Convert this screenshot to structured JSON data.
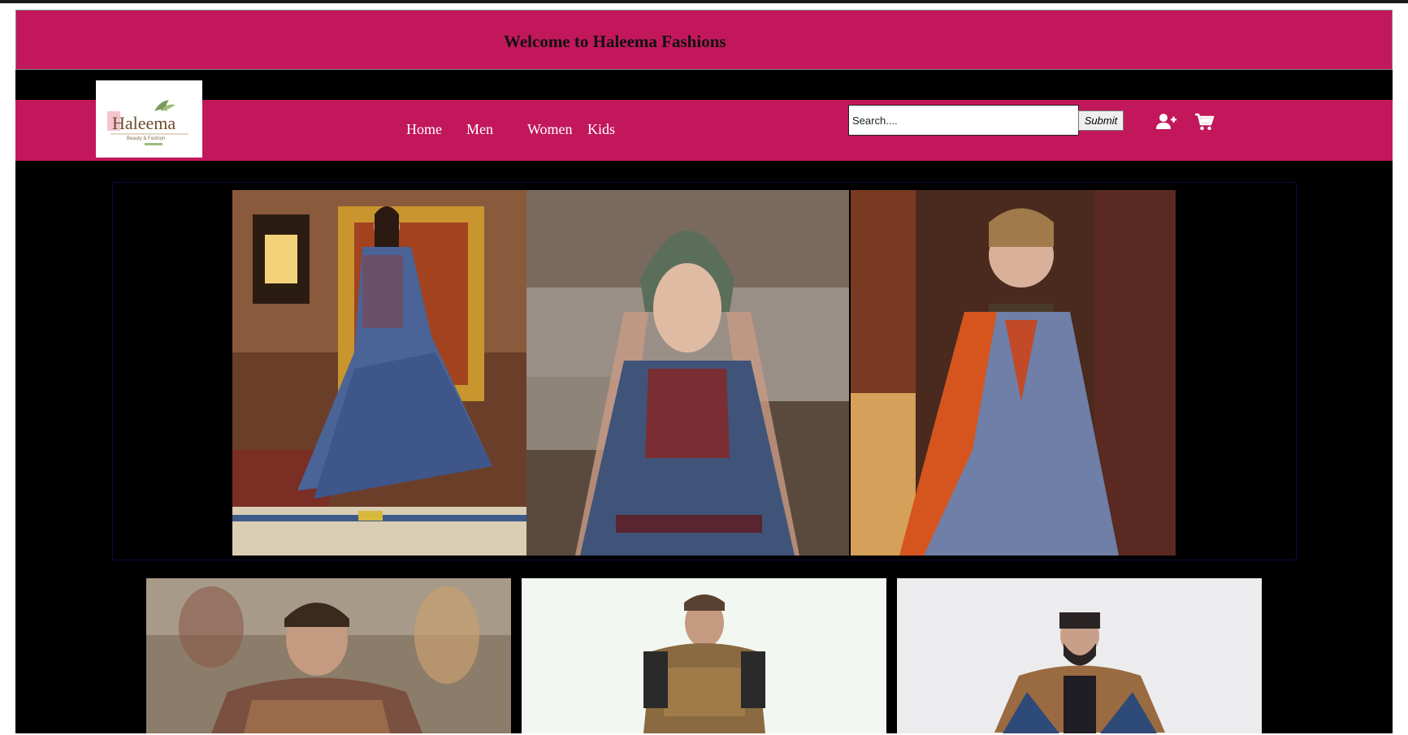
{
  "banner": {
    "welcome_text": "Welcome to Haleema Fashions"
  },
  "logo": {
    "brand": "Haleema",
    "tagline": "Beauty & Fashion"
  },
  "nav": {
    "items": [
      {
        "label": "Home"
      },
      {
        "label": "Men"
      },
      {
        "label": "Women"
      },
      {
        "label": "Kids"
      }
    ]
  },
  "search": {
    "placeholder": "Search....",
    "value": "",
    "submit_label": "Submit"
  },
  "icons": {
    "account": "add-user-icon",
    "cart": "cart-icon"
  },
  "colors": {
    "brand": "#c2185b",
    "background": "#000000",
    "nav_text": "#ffffff"
  },
  "slider": {
    "images": [
      "slide-image-1",
      "slide-image-2",
      "slide-image-3"
    ]
  },
  "products": {
    "cards": [
      "product-card-1",
      "product-card-2",
      "product-card-3"
    ]
  }
}
